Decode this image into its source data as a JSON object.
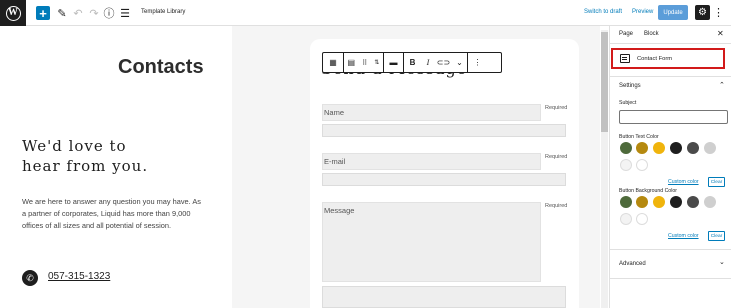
{
  "toolbar": {
    "add_glyph": "+",
    "doc_title": "Template Library",
    "switch_draft": "Switch to draft",
    "preview": "Preview",
    "update": "Update"
  },
  "page": {
    "title": "Contacts",
    "heading_line1": "We'd love to",
    "heading_line2": "hear from you.",
    "about": "We are here to answer any question you may have. As a partner of corporates, Liquid has more than 9,000 offices of all sizes and all potential of session.",
    "phone": "057-315-1323"
  },
  "form": {
    "heading": "Send a Message",
    "required": "Required",
    "fields": [
      {
        "label": "Name"
      },
      {
        "label": "E-mail"
      },
      {
        "label": "Message"
      }
    ]
  },
  "sidebar": {
    "tab_page": "Page",
    "tab_block": "Block",
    "block_name": "Contact Form",
    "settings_title": "Settings",
    "subject_label": "Subject",
    "button_text_color_label": "Button Text Color",
    "button_bg_color_label": "Button Background Color",
    "custom_color": "Custom color",
    "clear": "Clear",
    "advanced": "Advanced",
    "palette": [
      "#4e6a3b",
      "#b5890f",
      "#f0b40c",
      "#1e1e1e",
      "#4a4a4a",
      "#cfcfcf",
      "#f3f3f3",
      "#ffffff"
    ]
  }
}
